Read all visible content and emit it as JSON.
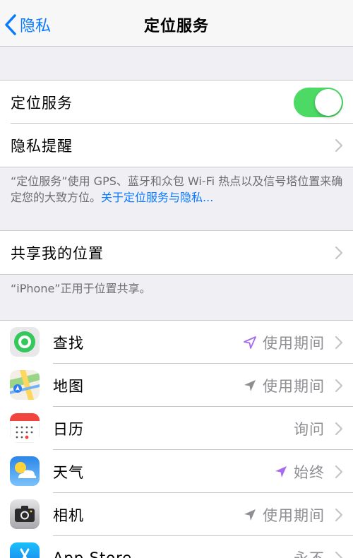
{
  "nav": {
    "back_label": "隐私",
    "title": "定位服务"
  },
  "location": {
    "label": "定位服务",
    "toggle_on": true
  },
  "privacy_alerts": {
    "label": "隐私提醒"
  },
  "info": {
    "text": "“定位服务”使用 GPS、蓝牙和众包 Wi-Fi 热点以及信号塔位置来确定您的大致方位。",
    "link": "关于定位服务与隐私..."
  },
  "share": {
    "label": "共享我的位置",
    "footer": "“iPhone”正用于位置共享。"
  },
  "apps": [
    {
      "name": "查找",
      "value": "使用期间",
      "arrow": "outline-purple",
      "icon": "find-my-icon"
    },
    {
      "name": "地图",
      "value": "使用期间",
      "arrow": "gray",
      "icon": "maps-icon"
    },
    {
      "name": "日历",
      "value": "询问",
      "arrow": "none",
      "icon": "calendar-icon"
    },
    {
      "name": "天气",
      "value": "始终",
      "arrow": "purple",
      "icon": "weather-icon"
    },
    {
      "name": "相机",
      "value": "使用期间",
      "arrow": "gray",
      "icon": "camera-icon"
    },
    {
      "name": "App Store",
      "value": "永不",
      "arrow": "none",
      "icon": "app-store-icon"
    }
  ],
  "colors": {
    "accent": "#0a7aff",
    "toggle_on": "#4cd964",
    "arrow_purple": "#a66bf0",
    "arrow_gray": "#8e8e93"
  }
}
